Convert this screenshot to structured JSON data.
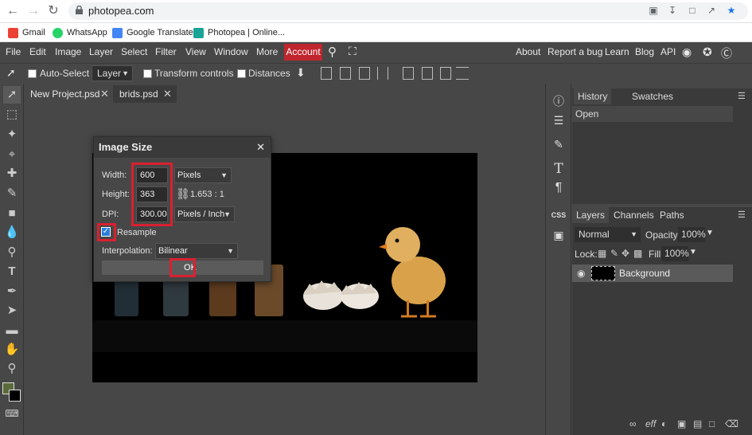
{
  "browser": {
    "url": "photopea.com",
    "bookmarks": [
      {
        "label": "Gmail",
        "color": "#ea4335"
      },
      {
        "label": "WhatsApp",
        "color": "#25d366"
      },
      {
        "label": "Google Translate",
        "color": "#4285f4"
      },
      {
        "label": "Photopea | Online...",
        "color": "#18a497"
      }
    ]
  },
  "menubar": {
    "items": [
      "File",
      "Edit",
      "Image",
      "Layer",
      "Select",
      "Filter",
      "View",
      "Window",
      "More"
    ],
    "account": "Account",
    "right_items": [
      "About",
      "Report a bug",
      "Learn",
      "Blog",
      "API"
    ]
  },
  "optionsbar": {
    "auto_select": "Auto-Select",
    "layer_select": "Layer",
    "transform_controls": "Transform controls",
    "distances": "Distances"
  },
  "tabs": [
    {
      "label": "New Project.psd"
    },
    {
      "label": "brids.psd"
    }
  ],
  "dialog": {
    "title": "Image Size",
    "width_label": "Width:",
    "width_value": "600",
    "width_unit": "Pixels",
    "height_label": "Height:",
    "height_value": "363",
    "ratio": "1.653 : 1",
    "dpi_label": "DPI:",
    "dpi_value": "300.000",
    "dpi_unit": "Pixels / Inch",
    "resample_label": "Resample",
    "resample_checked": true,
    "interp_label": "Interpolation:",
    "interp_value": "Bilinear",
    "ok_label": "OK"
  },
  "history_panel": {
    "tabs": [
      "History",
      "Swatches"
    ],
    "items": [
      "Open"
    ]
  },
  "layers_panel": {
    "tabs": [
      "Layers",
      "Channels",
      "Paths"
    ],
    "blend_mode": "Normal",
    "opacity_label": "Opacity:",
    "opacity_value": "100%",
    "lock_label": "Lock:",
    "fill_label": "Fill:",
    "fill_value": "100%",
    "layers": [
      {
        "name": "Background"
      }
    ]
  },
  "colors": {
    "account_red": "#c0262d",
    "highlight_red": "#d92030",
    "panel_bg": "#474747"
  }
}
